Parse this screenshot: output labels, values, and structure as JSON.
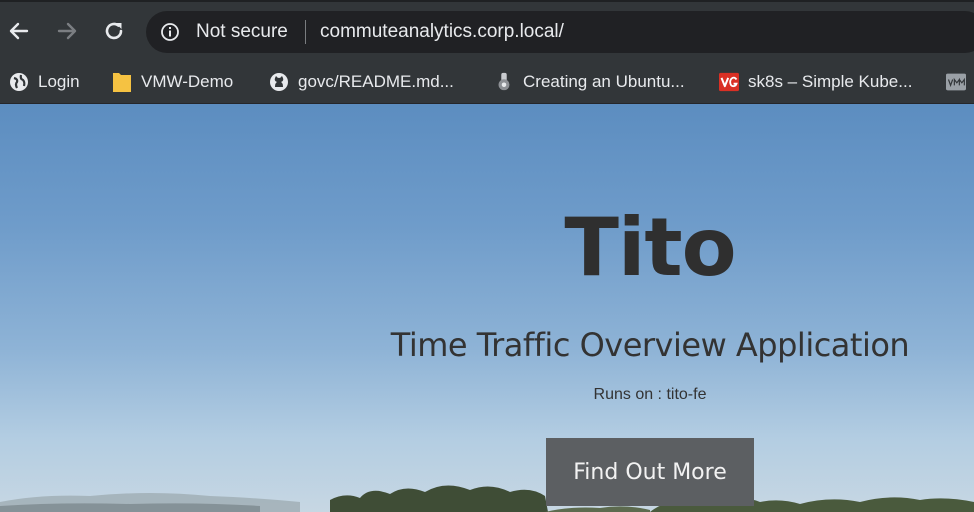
{
  "browser": {
    "security_label": "Not secure",
    "url": "commuteanalytics.corp.local/"
  },
  "bookmarks": [
    {
      "label": "Login",
      "icon": "globe-icon"
    },
    {
      "label": "VMW-Demo",
      "icon": "folder-icon"
    },
    {
      "label": "govc/README.md...",
      "icon": "github-icon"
    },
    {
      "label": "Creating an Ubuntu...",
      "icon": "ubuntu-icon"
    },
    {
      "label": "sk8s – Simple Kube...",
      "icon": "vg-icon"
    },
    {
      "label": "",
      "icon": "vm-icon"
    }
  ],
  "page": {
    "title": "Tito",
    "subtitle": "Time Traffic Overview Application",
    "runs_on": "Runs on : tito-fe",
    "cta_label": "Find Out More"
  },
  "colors": {
    "toolbar": "#323639",
    "omnibox": "#202124",
    "sky_top": "#5c8dc0",
    "button": "#5c5f62",
    "folder": "#f5c242",
    "vg_red": "#d93025"
  }
}
